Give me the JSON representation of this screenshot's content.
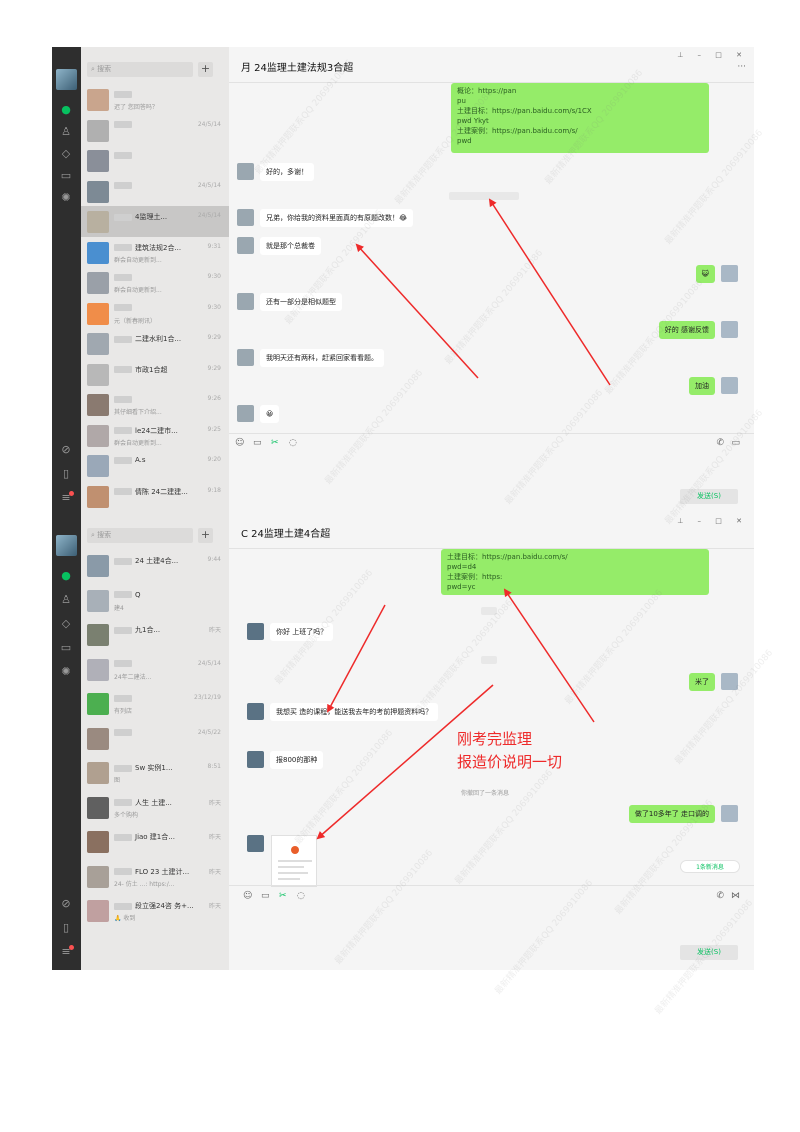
{
  "search_placeholder": "搜索",
  "plus_label": "+",
  "window1": {
    "title": "月 24监理土建法规3合超",
    "chats": [
      {
        "name": "",
        "preview": "迟了 您回答吗？",
        "time": "",
        "color": "#c9a58d"
      },
      {
        "name": "",
        "preview": "",
        "time": "24/5/14",
        "color": "#b0b0b0"
      },
      {
        "name": "",
        "preview": "",
        "time": "",
        "color": "#8a8f99"
      },
      {
        "name": "",
        "preview": "",
        "time": "24/5/14",
        "color": "#7d8a95"
      },
      {
        "name": "4监理土...",
        "preview": "",
        "time": "24/5/14",
        "color": "#b8b0a0",
        "selected": true
      },
      {
        "name": "建筑法规2合...",
        "preview": "群会自动更新到...",
        "time": "9:31",
        "color": "#4a8fd0"
      },
      {
        "name": "",
        "preview": "群会自动更新到...",
        "time": "9:30",
        "color": "#9aa0a8"
      },
      {
        "name": "",
        "preview": "元（新春刷讯）",
        "time": "9:30",
        "color": "#f08d49"
      },
      {
        "name": "二建水利1合...",
        "preview": "",
        "time": "9:29",
        "color": "#a0a8b0"
      },
      {
        "name": "市政1合超",
        "preview": "",
        "time": "9:29",
        "color": "#b8b8b8"
      },
      {
        "name": "",
        "preview": "其仔细看下介绍...",
        "time": "9:26",
        "color": "#8a7a70"
      },
      {
        "name": "le24二建市...",
        "preview": "群会自动更新到...",
        "time": "9:25",
        "color": "#b0a8a8"
      },
      {
        "name": "A.s",
        "preview": "",
        "time": "9:20",
        "color": "#9aa8b8"
      },
      {
        "name": "倩陈 24二建建...",
        "preview": "",
        "time": "9:18",
        "color": "#c09070"
      }
    ],
    "links": {
      "line1": "概论：https://pan",
      "line2": "pu",
      "line3": "土建目标：https://pan.baidu.com/s/1CX",
      "line4": "pwd    Ykyt",
      "line5": "土建案例：https://pan.baidu.com/s/",
      "line6": "pwd"
    },
    "messages_in": [
      "好的，多谢！",
      "兄弟，你给我的资料里面真的有原题改数！😂",
      "就是那个总裁卷",
      "还有一部分是相似题型",
      "我明天还有两科，赶紧回家看看题。",
      "😀"
    ],
    "messages_out": [
      "😺",
      "好的 感谢反馈",
      "加油"
    ],
    "send_label": "发送(S)"
  },
  "window2": {
    "title": "C    24监理土建4合超",
    "chats": [
      {
        "name": "24 土建4合...",
        "preview": "",
        "time": "9:44",
        "color": "#8a9aa8"
      },
      {
        "name": "Q",
        "preview": "建4",
        "time": "",
        "color": "#a8b0b8"
      },
      {
        "name": "九1合...",
        "preview": "",
        "time": "昨天",
        "color": "#7a8070"
      },
      {
        "name": "",
        "preview": "24年二建法...",
        "time": "24/5/14",
        "color": "#b0b0b8"
      },
      {
        "name": "",
        "preview": "有列店",
        "time": "23/12/19",
        "color": "#4caf50"
      },
      {
        "name": "",
        "preview": "",
        "time": "24/5/22",
        "color": "#9a8a80"
      },
      {
        "name": "Sw 实例1...",
        "preview": "图",
        "time": "8:51",
        "color": "#b0a090"
      },
      {
        "name": "人生 土建...",
        "preview": "多个购构",
        "time": "昨天",
        "color": "#606060"
      },
      {
        "name": "Jiao 建1合...",
        "preview": "",
        "time": "昨天",
        "color": "#8a7060"
      },
      {
        "name": "FLO 23 土建计...",
        "preview": "24- 仿土 ...: https:/...",
        "time": "昨天",
        "color": "#a8a098"
      },
      {
        "name": "段立强24咨 务+...",
        "preview": "🙏 收到",
        "time": "昨天",
        "color": "#c0a0a0"
      }
    ],
    "links": {
      "line1": "土建目标：https://pan.baidu.com/s/",
      "line2": "pwd=d4",
      "line3": "土建案例：https:",
      "line4": "pwd=yc"
    },
    "messages_in": [
      "你好 上班了吗？",
      "我想买 造的课程，能送我去年的考前押题资料吗？",
      "报800的那种"
    ],
    "messages_out": [
      "米了",
      "做了10多年了 走口调的"
    ],
    "sys_text": "你撤回了一条消息",
    "new_msg": "1条新消息",
    "send_label": "发送(S)"
  },
  "annotation": {
    "line1": "刚考完监理",
    "line2": "报造价说明一切"
  },
  "watermark": "最新精准押题联系QQ 2069910086",
  "accent_color": "#07c160",
  "bubble_color": "#95ec69",
  "arrow_color": "#ee2a2a"
}
